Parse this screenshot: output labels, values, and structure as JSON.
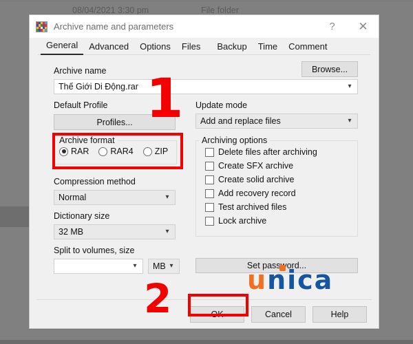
{
  "background": {
    "file_date": "08/04/2021 3:30 pm",
    "file_type": "File folder"
  },
  "dialog": {
    "title": "Archive name and parameters",
    "icon": "winrar-books-icon",
    "help_label": "?",
    "close_label": "✕",
    "tabs": [
      {
        "label": "General",
        "active": true
      },
      {
        "label": "Advanced",
        "active": false
      },
      {
        "label": "Options",
        "active": false
      },
      {
        "label": "Files",
        "active": false
      },
      {
        "label": "Backup",
        "active": false
      },
      {
        "label": "Time",
        "active": false
      },
      {
        "label": "Comment",
        "active": false
      }
    ],
    "archive_name": {
      "label": "Archive name",
      "value": "Thế Giới Di Động.rar",
      "browse_label": "Browse..."
    },
    "default_profile": {
      "label": "Default Profile",
      "button_label": "Profiles..."
    },
    "update_mode": {
      "label": "Update mode",
      "value": "Add and replace files"
    },
    "archive_format": {
      "legend": "Archive format",
      "options": [
        {
          "label": "RAR",
          "selected": true
        },
        {
          "label": "RAR4",
          "selected": false
        },
        {
          "label": "ZIP",
          "selected": false
        }
      ]
    },
    "compression_method": {
      "label": "Compression method",
      "value": "Normal"
    },
    "dictionary_size": {
      "label": "Dictionary size",
      "value": "32 MB"
    },
    "split_to_volumes": {
      "label": "Split to volumes, size",
      "value": "",
      "unit": "MB"
    },
    "archiving_options": {
      "legend": "Archiving options",
      "items": [
        {
          "label": "Delete files after archiving",
          "checked": false
        },
        {
          "label": "Create SFX archive",
          "checked": false
        },
        {
          "label": "Create solid archive",
          "checked": false
        },
        {
          "label": "Add recovery record",
          "checked": false
        },
        {
          "label": "Test archived files",
          "checked": false
        },
        {
          "label": "Lock archive",
          "checked": false
        }
      ]
    },
    "set_password_label": "Set password...",
    "footer": {
      "ok_label": "OK",
      "cancel_label": "Cancel",
      "help_label": "Help"
    }
  },
  "annotations": {
    "step_one": "1",
    "step_two": "2",
    "highlight_color": "#f40000"
  },
  "watermark": {
    "text_first": "u",
    "text_rest": "nica",
    "color_first": "#f07020",
    "color_rest": "#15569e"
  }
}
